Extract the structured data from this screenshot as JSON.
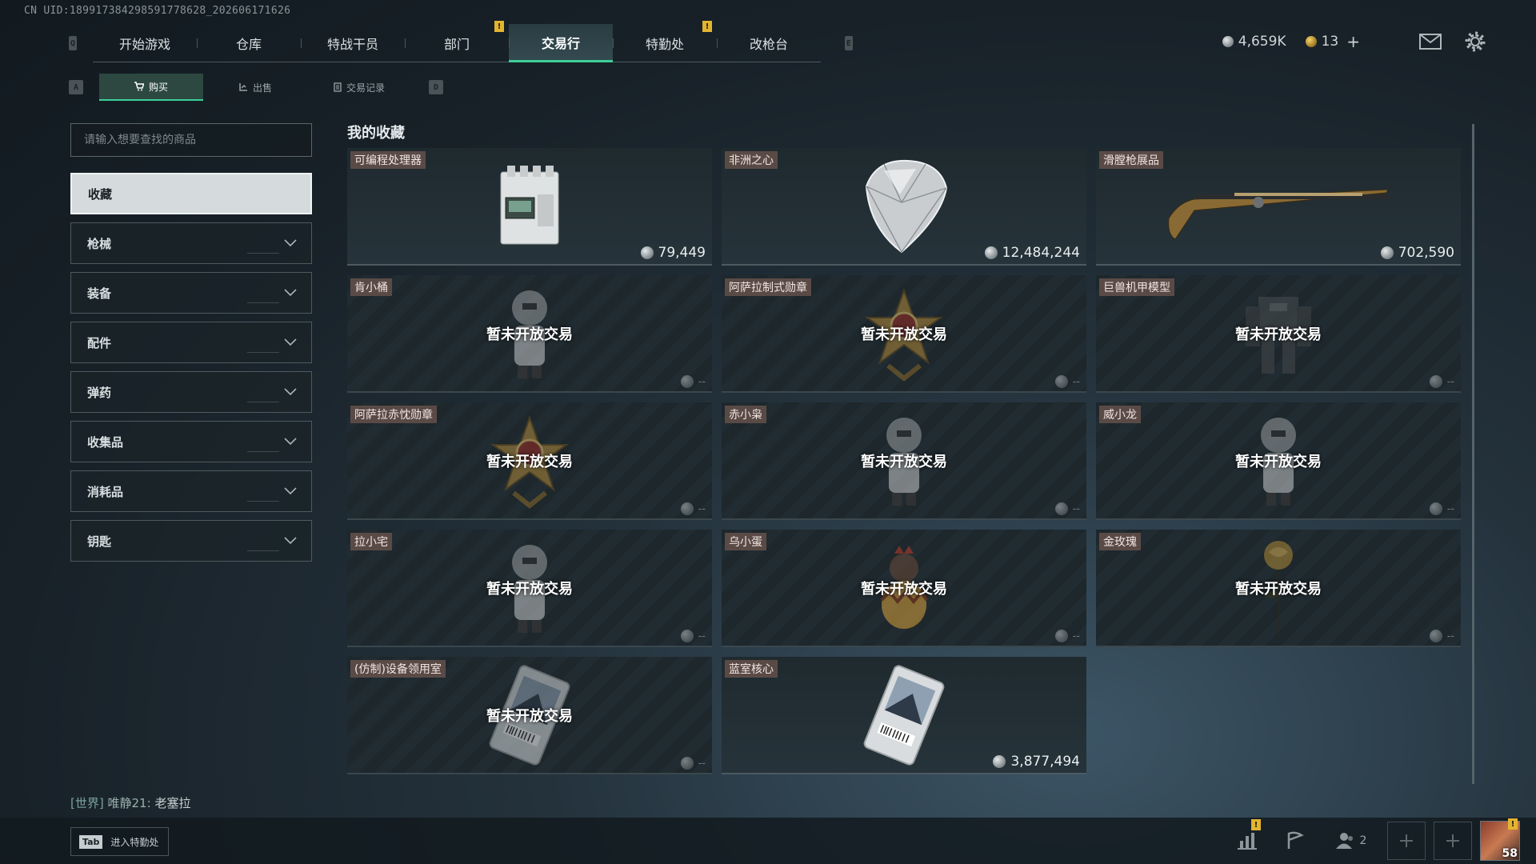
{
  "uid_text": "CN UID:1899173842985917786​28_202606171626",
  "nav": {
    "left_key": "Q",
    "right_key": "E",
    "tabs": [
      {
        "label": "开始游戏",
        "warn": false
      },
      {
        "label": "仓库",
        "warn": false
      },
      {
        "label": "特战干员",
        "warn": false
      },
      {
        "label": "部门",
        "warn": true
      },
      {
        "label": "交易行",
        "warn": false,
        "active": true
      },
      {
        "label": "特勤处",
        "warn": true
      },
      {
        "label": "改枪台",
        "warn": false
      }
    ],
    "warn_mark": "!"
  },
  "currency": {
    "silver": "4,659K",
    "gold": "13",
    "add": "+"
  },
  "subnav": {
    "left_key": "A",
    "right_key": "D",
    "tabs": [
      {
        "label": "购买",
        "icon": "cart-icon",
        "active": true
      },
      {
        "label": "出售",
        "icon": "sell-icon"
      },
      {
        "label": "交易记录",
        "icon": "record-icon"
      }
    ]
  },
  "search": {
    "placeholder": "请输入想要查找的商品"
  },
  "categories": [
    {
      "label": "收藏",
      "active": true
    },
    {
      "label": "枪械"
    },
    {
      "label": "装备"
    },
    {
      "label": "配件"
    },
    {
      "label": "弹药"
    },
    {
      "label": "收集品"
    },
    {
      "label": "消耗品"
    },
    {
      "label": "钥匙"
    }
  ],
  "collection": {
    "title": "我的收藏",
    "closed_text": "暂未开放交易",
    "no_price": "--",
    "items": [
      {
        "name": "可编程处理器",
        "price": "79,449",
        "open": true,
        "icon": "processor-icon"
      },
      {
        "name": "非洲之心",
        "price": "12,484,244",
        "open": true,
        "icon": "diamond-icon"
      },
      {
        "name": "滑膛枪展品",
        "price": "702,590",
        "open": true,
        "icon": "musket-icon"
      },
      {
        "name": "肯小桶",
        "open": false,
        "icon": "figure-icon"
      },
      {
        "name": "阿萨拉制式勋章",
        "open": false,
        "icon": "medal-icon"
      },
      {
        "name": "巨兽机甲模型",
        "open": false,
        "icon": "mech-icon"
      },
      {
        "name": "阿萨拉赤忱勋章",
        "open": false,
        "icon": "medal-icon"
      },
      {
        "name": "赤小枭",
        "open": false,
        "icon": "figure-icon"
      },
      {
        "name": "威小龙",
        "open": false,
        "icon": "figure-icon"
      },
      {
        "name": "拉小宅",
        "open": false,
        "icon": "figure-icon"
      },
      {
        "name": "乌小蛋",
        "open": false,
        "icon": "egg-icon"
      },
      {
        "name": "金玫瑰",
        "open": false,
        "icon": "rose-icon"
      },
      {
        "name": "(仿制)设备领用室",
        "open": false,
        "icon": "keycard-icon"
      },
      {
        "name": "蓝室核心",
        "price": "3,877,494",
        "open": true,
        "icon": "keycard-icon"
      }
    ]
  },
  "chat": {
    "channel": "[世界]",
    "user": "唯静21:",
    "message": "老塞拉"
  },
  "bottom": {
    "tab_key": "Tab",
    "tab_label": "进入特勤处",
    "friends_count": "2",
    "level": "58",
    "warn_mark": "!"
  },
  "colors": {
    "accent": "#3ecf9a",
    "warning": "#e3b42f",
    "item_tag": "#5a4a46"
  }
}
